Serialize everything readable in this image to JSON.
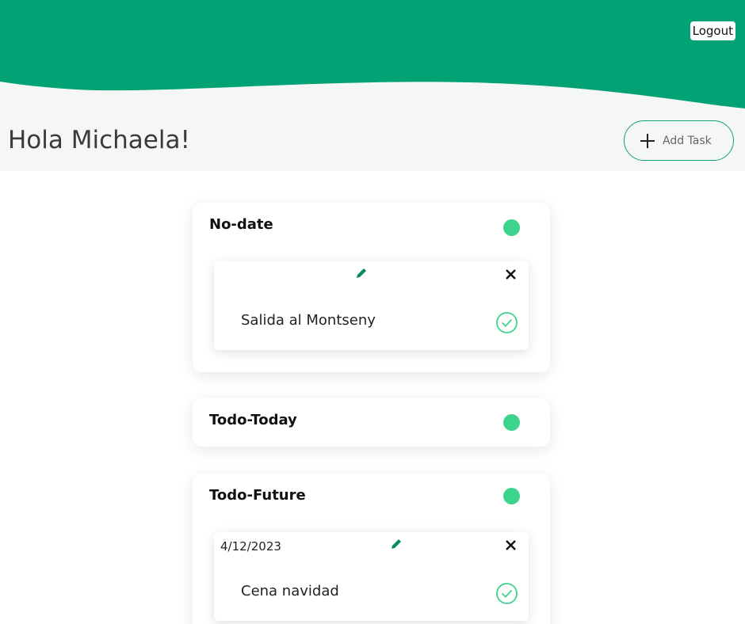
{
  "header": {
    "logout_label": "Logout",
    "greeting": "Hola Michaela!",
    "add_task_label": "Add Task"
  },
  "colors": {
    "brand_green": "#02a274",
    "status_green": "#3ed38c",
    "subheader_bg": "#f4f7f6"
  },
  "sections": [
    {
      "title": "No-date",
      "tasks": [
        {
          "date": "",
          "name": "Salida al Montseny"
        }
      ]
    },
    {
      "title": "Todo-Today",
      "tasks": []
    },
    {
      "title": "Todo-Future",
      "tasks": [
        {
          "date": "4/12/2023",
          "name": "Cena navidad"
        }
      ]
    }
  ],
  "icons": [
    "plus-icon",
    "pencil-icon",
    "close-icon",
    "check-circle-icon"
  ]
}
